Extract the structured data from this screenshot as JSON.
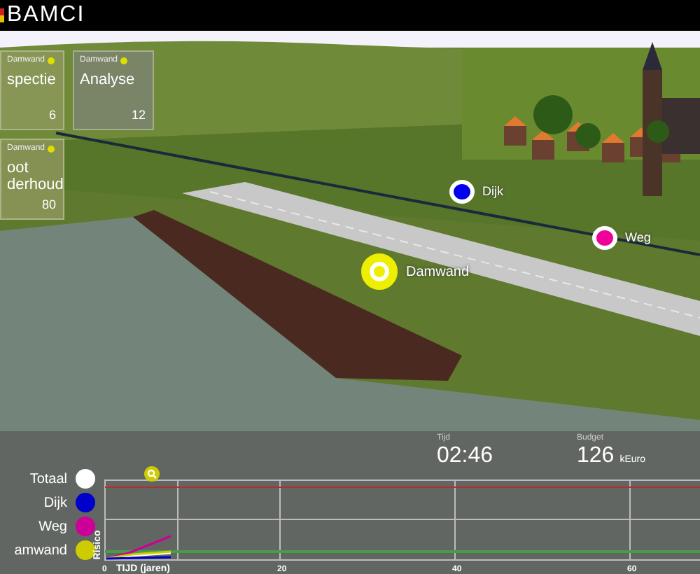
{
  "app": {
    "title": "BAMCI"
  },
  "cards": [
    {
      "tag": "Damwand",
      "title": "spectie",
      "count": "6"
    },
    {
      "tag": "Damwand",
      "title": "Analyse",
      "count": "12"
    },
    {
      "tag": "Damwand",
      "title": "oot\nderhoud",
      "count": "80"
    }
  ],
  "markers": [
    {
      "label": "Dijk",
      "color": "#0000ee",
      "selected": false
    },
    {
      "label": "Weg",
      "color": "#ee0099",
      "selected": false
    },
    {
      "label": "Damwand",
      "color": "#eeee00",
      "selected": true
    }
  ],
  "legend": [
    {
      "label": "Totaal",
      "color": "#ffffff"
    },
    {
      "label": "Dijk",
      "color": "#0000cc"
    },
    {
      "label": "Weg",
      "color": "#cc0099"
    },
    {
      "label": "amwand",
      "color": "#cccc00"
    }
  ],
  "stats": [
    {
      "label": "Tijd",
      "value": "02:46"
    },
    {
      "label": "Budget",
      "value": "126",
      "unit": "kEuro"
    }
  ],
  "chart": {
    "ylabel": "Risico",
    "xlabel": "TIJD (jaren)",
    "xtick_labels": [
      "0",
      "20",
      "40",
      "60"
    ]
  }
}
